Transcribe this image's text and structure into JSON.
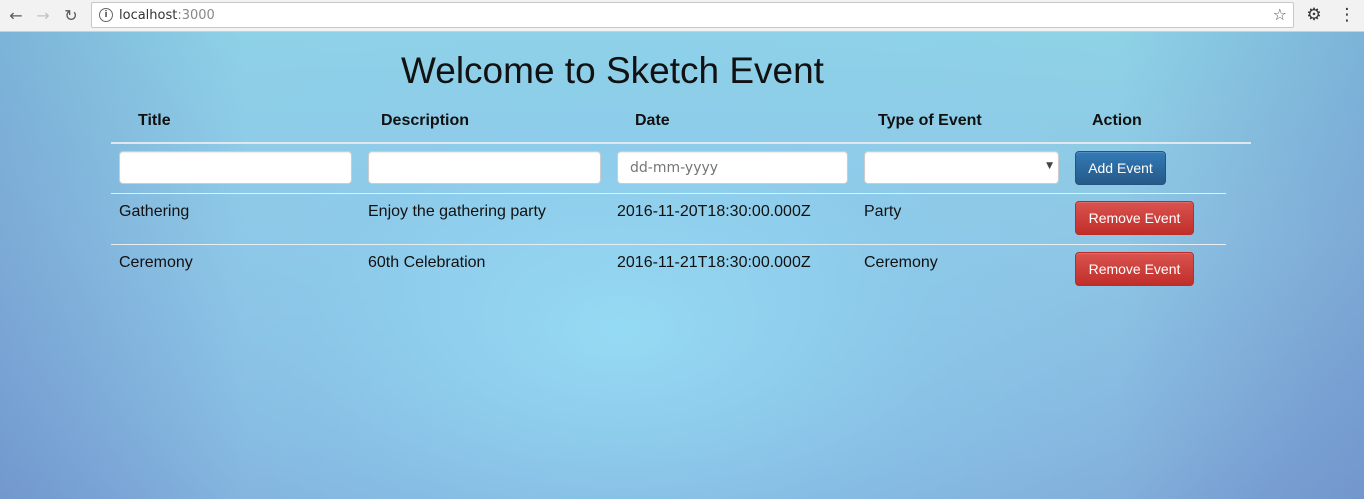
{
  "browser": {
    "url_host": "localhost",
    "url_port": ":3000"
  },
  "page": {
    "title": "Welcome to Sketch Event"
  },
  "table": {
    "headers": [
      "Title",
      "Description",
      "Date",
      "Type of Event",
      "Action"
    ],
    "form": {
      "title_value": "",
      "description_value": "",
      "date_placeholder": "dd-mm-yyyy",
      "type_value": "",
      "add_label": "Add Event"
    },
    "rows": [
      {
        "title": "Gathering",
        "description": "Enjoy the gathering party",
        "date": "2016-11-20T18:30:00.000Z",
        "type": "Party",
        "action": "Remove Event"
      },
      {
        "title": "Ceremony",
        "description": "60th Celebration",
        "date": "2016-11-21T18:30:00.000Z",
        "type": "Ceremony",
        "action": "Remove Event"
      }
    ]
  },
  "colors": {
    "primary": "#337ab7",
    "danger": "#d9534f"
  }
}
